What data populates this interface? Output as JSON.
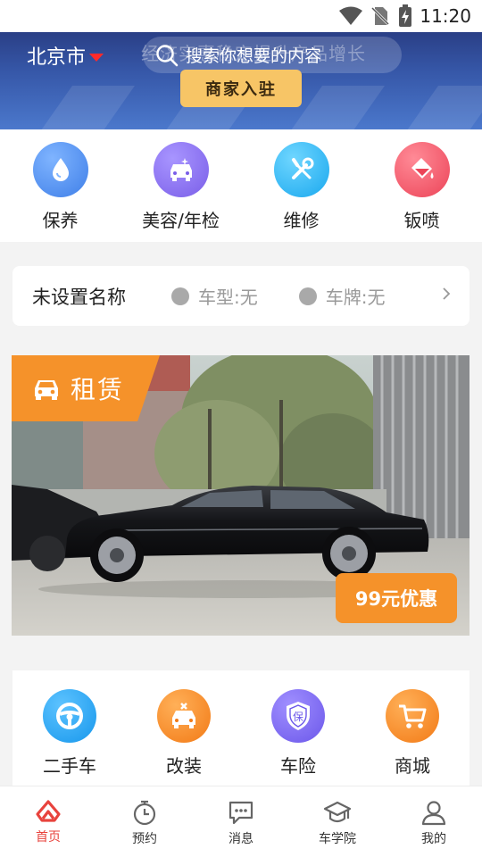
{
  "status_bar": {
    "time": "11:20"
  },
  "header": {
    "city": "北京市",
    "search_placeholder": "搜索你想要的内容",
    "background_text": "经济实惠稳定提升产品增长",
    "merchant_button": "商家入驻"
  },
  "services": [
    {
      "label": "保养",
      "icon": "water-drop-icon",
      "color": "#4a8df0"
    },
    {
      "label": "美容/年检",
      "icon": "car-wash-icon",
      "color": "#8a6ef0"
    },
    {
      "label": "维修",
      "icon": "wrench-screwdriver-icon",
      "color": "#27b8f0"
    },
    {
      "label": "钣喷",
      "icon": "paint-bucket-icon",
      "color": "#f05668"
    }
  ],
  "vehicle": {
    "name": "未设置名称",
    "model": "车型:无",
    "plate": "车牌:无"
  },
  "rental": {
    "tag": "租赁",
    "promo": "99元优惠"
  },
  "services2": [
    {
      "label": "二手车",
      "icon": "steering-wheel-icon",
      "color": "#1fa6f2"
    },
    {
      "label": "改装",
      "icon": "car-tools-icon",
      "color": "#f5861f"
    },
    {
      "label": "车险",
      "icon": "insurance-shield-icon",
      "color": "#7a67f2"
    },
    {
      "label": "商城",
      "icon": "shopping-cart-icon",
      "color": "#f5861f"
    }
  ],
  "bottom_nav": [
    {
      "label": "首页",
      "icon": "home-icon",
      "active": true
    },
    {
      "label": "预约",
      "icon": "stopwatch-icon",
      "active": false
    },
    {
      "label": "消息",
      "icon": "message-icon",
      "active": false
    },
    {
      "label": "车学院",
      "icon": "graduation-cap-icon",
      "active": false
    },
    {
      "label": "我的",
      "icon": "user-icon",
      "active": false
    }
  ],
  "colors": {
    "accent_red": "#e8433d",
    "accent_orange": "#f5922a",
    "merchant_yellow": "#f7c566",
    "header_blue": "#3657a8"
  }
}
